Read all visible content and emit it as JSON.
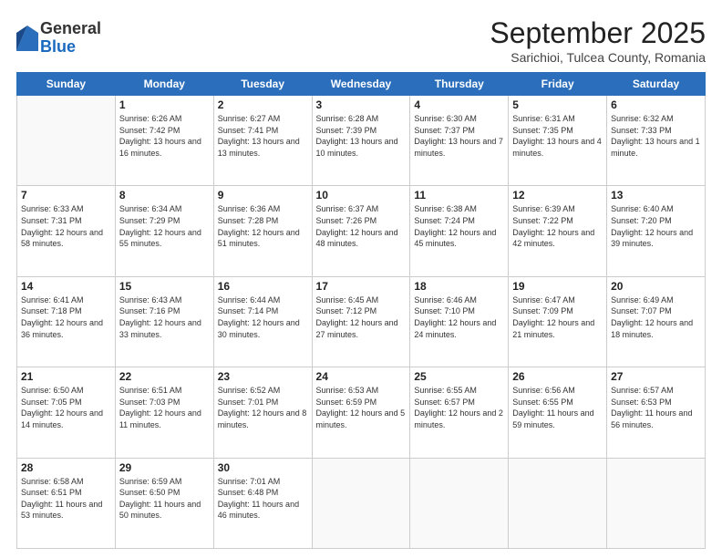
{
  "logo": {
    "general": "General",
    "blue": "Blue"
  },
  "header": {
    "month": "September 2025",
    "location": "Sarichioi, Tulcea County, Romania"
  },
  "weekdays": [
    "Sunday",
    "Monday",
    "Tuesday",
    "Wednesday",
    "Thursday",
    "Friday",
    "Saturday"
  ],
  "weeks": [
    [
      {
        "day": "",
        "sunrise": "",
        "sunset": "",
        "daylight": ""
      },
      {
        "day": "1",
        "sunrise": "Sunrise: 6:26 AM",
        "sunset": "Sunset: 7:42 PM",
        "daylight": "Daylight: 13 hours and 16 minutes."
      },
      {
        "day": "2",
        "sunrise": "Sunrise: 6:27 AM",
        "sunset": "Sunset: 7:41 PM",
        "daylight": "Daylight: 13 hours and 13 minutes."
      },
      {
        "day": "3",
        "sunrise": "Sunrise: 6:28 AM",
        "sunset": "Sunset: 7:39 PM",
        "daylight": "Daylight: 13 hours and 10 minutes."
      },
      {
        "day": "4",
        "sunrise": "Sunrise: 6:30 AM",
        "sunset": "Sunset: 7:37 PM",
        "daylight": "Daylight: 13 hours and 7 minutes."
      },
      {
        "day": "5",
        "sunrise": "Sunrise: 6:31 AM",
        "sunset": "Sunset: 7:35 PM",
        "daylight": "Daylight: 13 hours and 4 minutes."
      },
      {
        "day": "6",
        "sunrise": "Sunrise: 6:32 AM",
        "sunset": "Sunset: 7:33 PM",
        "daylight": "Daylight: 13 hours and 1 minute."
      }
    ],
    [
      {
        "day": "7",
        "sunrise": "Sunrise: 6:33 AM",
        "sunset": "Sunset: 7:31 PM",
        "daylight": "Daylight: 12 hours and 58 minutes."
      },
      {
        "day": "8",
        "sunrise": "Sunrise: 6:34 AM",
        "sunset": "Sunset: 7:29 PM",
        "daylight": "Daylight: 12 hours and 55 minutes."
      },
      {
        "day": "9",
        "sunrise": "Sunrise: 6:36 AM",
        "sunset": "Sunset: 7:28 PM",
        "daylight": "Daylight: 12 hours and 51 minutes."
      },
      {
        "day": "10",
        "sunrise": "Sunrise: 6:37 AM",
        "sunset": "Sunset: 7:26 PM",
        "daylight": "Daylight: 12 hours and 48 minutes."
      },
      {
        "day": "11",
        "sunrise": "Sunrise: 6:38 AM",
        "sunset": "Sunset: 7:24 PM",
        "daylight": "Daylight: 12 hours and 45 minutes."
      },
      {
        "day": "12",
        "sunrise": "Sunrise: 6:39 AM",
        "sunset": "Sunset: 7:22 PM",
        "daylight": "Daylight: 12 hours and 42 minutes."
      },
      {
        "day": "13",
        "sunrise": "Sunrise: 6:40 AM",
        "sunset": "Sunset: 7:20 PM",
        "daylight": "Daylight: 12 hours and 39 minutes."
      }
    ],
    [
      {
        "day": "14",
        "sunrise": "Sunrise: 6:41 AM",
        "sunset": "Sunset: 7:18 PM",
        "daylight": "Daylight: 12 hours and 36 minutes."
      },
      {
        "day": "15",
        "sunrise": "Sunrise: 6:43 AM",
        "sunset": "Sunset: 7:16 PM",
        "daylight": "Daylight: 12 hours and 33 minutes."
      },
      {
        "day": "16",
        "sunrise": "Sunrise: 6:44 AM",
        "sunset": "Sunset: 7:14 PM",
        "daylight": "Daylight: 12 hours and 30 minutes."
      },
      {
        "day": "17",
        "sunrise": "Sunrise: 6:45 AM",
        "sunset": "Sunset: 7:12 PM",
        "daylight": "Daylight: 12 hours and 27 minutes."
      },
      {
        "day": "18",
        "sunrise": "Sunrise: 6:46 AM",
        "sunset": "Sunset: 7:10 PM",
        "daylight": "Daylight: 12 hours and 24 minutes."
      },
      {
        "day": "19",
        "sunrise": "Sunrise: 6:47 AM",
        "sunset": "Sunset: 7:09 PM",
        "daylight": "Daylight: 12 hours and 21 minutes."
      },
      {
        "day": "20",
        "sunrise": "Sunrise: 6:49 AM",
        "sunset": "Sunset: 7:07 PM",
        "daylight": "Daylight: 12 hours and 18 minutes."
      }
    ],
    [
      {
        "day": "21",
        "sunrise": "Sunrise: 6:50 AM",
        "sunset": "Sunset: 7:05 PM",
        "daylight": "Daylight: 12 hours and 14 minutes."
      },
      {
        "day": "22",
        "sunrise": "Sunrise: 6:51 AM",
        "sunset": "Sunset: 7:03 PM",
        "daylight": "Daylight: 12 hours and 11 minutes."
      },
      {
        "day": "23",
        "sunrise": "Sunrise: 6:52 AM",
        "sunset": "Sunset: 7:01 PM",
        "daylight": "Daylight: 12 hours and 8 minutes."
      },
      {
        "day": "24",
        "sunrise": "Sunrise: 6:53 AM",
        "sunset": "Sunset: 6:59 PM",
        "daylight": "Daylight: 12 hours and 5 minutes."
      },
      {
        "day": "25",
        "sunrise": "Sunrise: 6:55 AM",
        "sunset": "Sunset: 6:57 PM",
        "daylight": "Daylight: 12 hours and 2 minutes."
      },
      {
        "day": "26",
        "sunrise": "Sunrise: 6:56 AM",
        "sunset": "Sunset: 6:55 PM",
        "daylight": "Daylight: 11 hours and 59 minutes."
      },
      {
        "day": "27",
        "sunrise": "Sunrise: 6:57 AM",
        "sunset": "Sunset: 6:53 PM",
        "daylight": "Daylight: 11 hours and 56 minutes."
      }
    ],
    [
      {
        "day": "28",
        "sunrise": "Sunrise: 6:58 AM",
        "sunset": "Sunset: 6:51 PM",
        "daylight": "Daylight: 11 hours and 53 minutes."
      },
      {
        "day": "29",
        "sunrise": "Sunrise: 6:59 AM",
        "sunset": "Sunset: 6:50 PM",
        "daylight": "Daylight: 11 hours and 50 minutes."
      },
      {
        "day": "30",
        "sunrise": "Sunrise: 7:01 AM",
        "sunset": "Sunset: 6:48 PM",
        "daylight": "Daylight: 11 hours and 46 minutes."
      },
      {
        "day": "",
        "sunrise": "",
        "sunset": "",
        "daylight": ""
      },
      {
        "day": "",
        "sunrise": "",
        "sunset": "",
        "daylight": ""
      },
      {
        "day": "",
        "sunrise": "",
        "sunset": "",
        "daylight": ""
      },
      {
        "day": "",
        "sunrise": "",
        "sunset": "",
        "daylight": ""
      }
    ]
  ]
}
